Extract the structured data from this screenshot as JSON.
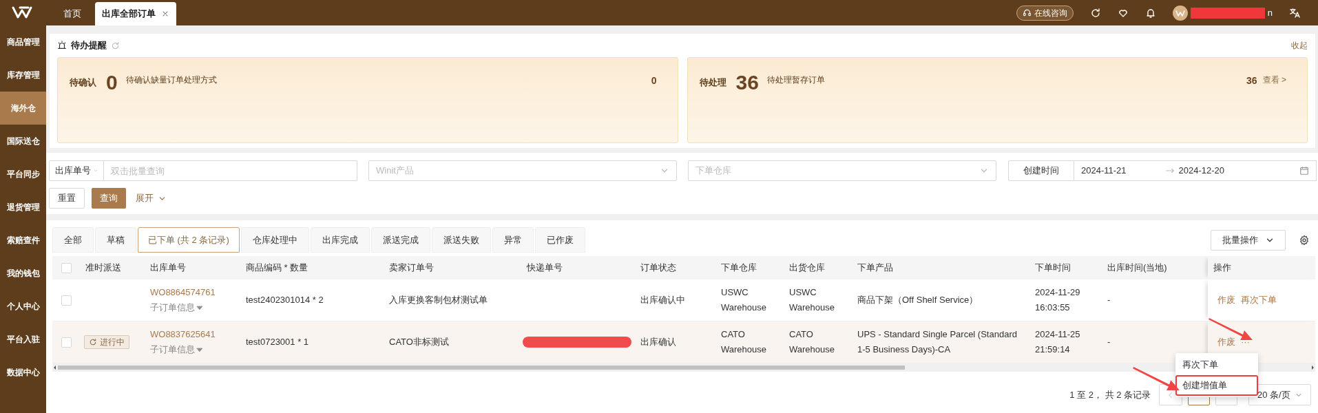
{
  "top_bar": {
    "tabs": [
      {
        "label": "首页",
        "selected": false,
        "closable": false
      },
      {
        "label": "出库全部订单",
        "selected": true,
        "closable": true
      }
    ],
    "consult_button": "在线咨询",
    "user_name": "n"
  },
  "sidebar": {
    "items": [
      {
        "label": "商品管理",
        "selected": false
      },
      {
        "label": "库存管理",
        "selected": false
      },
      {
        "label": "海外仓",
        "selected": true
      },
      {
        "label": "国际送仓",
        "selected": false
      },
      {
        "label": "平台同步",
        "selected": false
      },
      {
        "label": "退货管理",
        "selected": false
      },
      {
        "label": "索赔查件",
        "selected": false
      },
      {
        "label": "我的钱包",
        "selected": false
      },
      {
        "label": "个人中心",
        "selected": false
      },
      {
        "label": "平台入驻",
        "selected": false
      },
      {
        "label": "数据中心",
        "selected": false
      }
    ]
  },
  "reminders": {
    "title": "待办提醒",
    "collapse": "收起",
    "cards": [
      {
        "label": "待确认",
        "count": "0",
        "description": "待确认缺量订单处理方式",
        "total": "0"
      },
      {
        "label": "待处理",
        "count": "36",
        "description": "待处理暂存订单",
        "total": "36",
        "link": "查看 >"
      }
    ]
  },
  "filters": {
    "field_select": "出库单号",
    "search_placeholder": "双击批量查询",
    "product_placeholder": "Winit产品",
    "warehouse_placeholder": "下单仓库",
    "date_label": "创建时间",
    "date_from": "2024-11-21",
    "date_to": "2024-12-20",
    "reset": "重置",
    "query": "查询",
    "expand": "展开"
  },
  "status_tabs": [
    {
      "label": "全部",
      "selected": false
    },
    {
      "label": "草稿",
      "selected": false
    },
    {
      "label": "已下单 (共 2 条记录)",
      "selected": true
    },
    {
      "label": "仓库处理中",
      "selected": false
    },
    {
      "label": "出库完成",
      "selected": false
    },
    {
      "label": "派送完成",
      "selected": false
    },
    {
      "label": "派送失败",
      "selected": false
    },
    {
      "label": "异常",
      "selected": false
    },
    {
      "label": "已作废",
      "selected": false
    }
  ],
  "batch_button": "批量操作",
  "table": {
    "all_checked": false,
    "columns": [
      "准时派送",
      "出库单号",
      "商品编码 * 数量",
      "卖家订单号",
      "快递单号",
      "订单状态",
      "下单仓库",
      "出货仓库",
      "下单产品",
      "下单时间",
      "出库时间(当地)",
      "操作"
    ],
    "rows": [
      {
        "checked": false,
        "hovered": false,
        "order_no": "WO8864574761",
        "sub_info": "子订单信息",
        "sku_qty": "test2402301014 * 2",
        "seller_order": "入库更换客制包材测试单",
        "tracking_redacted": false,
        "status": "出库确认中",
        "order_warehouse": [
          "USWC",
          "Warehouse"
        ],
        "ship_warehouse": [
          "USWC",
          "Warehouse"
        ],
        "product": "商品下架（Off Shelf Service）",
        "order_time": [
          "2024-11-29",
          "16:03:55"
        ],
        "ship_time": "-",
        "actions": [
          "作废",
          "再次下单"
        ]
      },
      {
        "checked": false,
        "hovered": true,
        "on_time": "进行中",
        "order_no": "WO8837625641",
        "sub_info": "子订单信息",
        "sku_qty": "test0723001 * 1",
        "seller_order": "CATO非标测试",
        "tracking_redacted": true,
        "status": "出库确认",
        "order_warehouse": [
          "CATO",
          "Warehouse"
        ],
        "ship_warehouse": [
          "CATO",
          "Warehouse"
        ],
        "product": "UPS - Standard Single Parcel (Standard 1-5 Business Days)-CA",
        "order_time": [
          "2024-11-25",
          "21:59:14"
        ],
        "ship_time": "-",
        "actions": [
          "作废",
          "···"
        ]
      }
    ]
  },
  "row_menu": {
    "items": [
      {
        "label": "再次下单",
        "highlighted": false
      },
      {
        "label": "创建增值单",
        "highlighted": true
      }
    ]
  },
  "pagination": {
    "summary": "1 至 2， 共 2 条记录",
    "pages": [
      {
        "selected": true
      },
      {
        "selected": false
      }
    ],
    "page_size": "20 条/页"
  }
}
